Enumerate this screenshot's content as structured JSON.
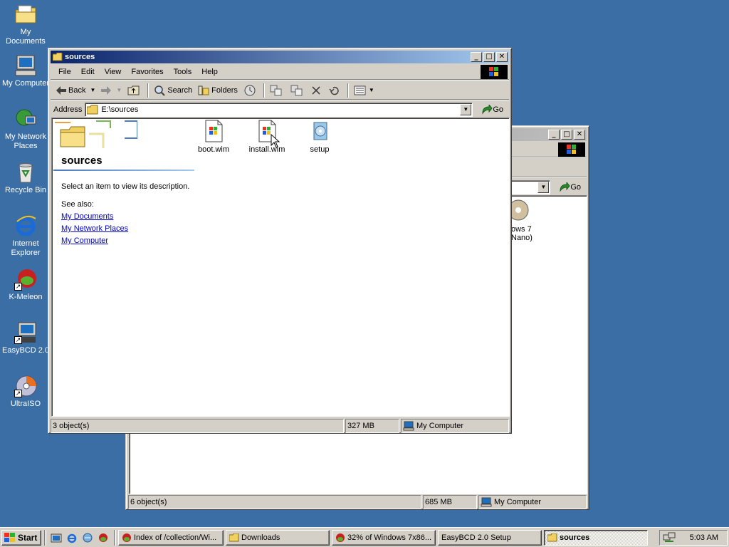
{
  "desktop": {
    "icons": [
      {
        "label": "My Documents",
        "icon": "my-documents-icon"
      },
      {
        "label": "My Computer",
        "icon": "my-computer-icon"
      },
      {
        "label": "My Network\nPlaces",
        "icon": "network-places-icon"
      },
      {
        "label": "Recycle Bin",
        "icon": "recycle-bin-icon"
      },
      {
        "label": "Internet\nExplorer",
        "icon": "internet-explorer-icon"
      },
      {
        "label": "K-Meleon",
        "icon": "k-meleon-icon"
      },
      {
        "label": "EasyBCD 2.0",
        "icon": "easybcd-icon"
      },
      {
        "label": "UltraISO",
        "icon": "ultraiso-icon"
      }
    ]
  },
  "back_window": {
    "go_label": "Go",
    "visible_item_text": "ows 7\nNano)",
    "status": {
      "objects": "6 object(s)",
      "size": "685 MB",
      "zone": "My Computer"
    }
  },
  "front_window": {
    "title": "sources",
    "menu": [
      "File",
      "Edit",
      "View",
      "Favorites",
      "Tools",
      "Help"
    ],
    "toolbar": {
      "back": "Back",
      "search": "Search",
      "folders": "Folders"
    },
    "address": {
      "label": "Address",
      "value": "E:\\sources",
      "go": "Go"
    },
    "webview": {
      "title": "sources",
      "description": "Select an item to view its description.",
      "see_also": "See also:",
      "links": [
        "My Documents",
        "My Network Places",
        "My Computer"
      ]
    },
    "files": [
      {
        "name": "boot.wim",
        "icon": "wim-file-icon"
      },
      {
        "name": "install.wim",
        "icon": "wim-file-icon"
      },
      {
        "name": "setup",
        "icon": "setup-icon"
      }
    ],
    "status": {
      "objects": "3 object(s)",
      "size": "327 MB",
      "zone": "My Computer"
    }
  },
  "taskbar": {
    "start": "Start",
    "tasks": [
      {
        "label": "Index of /collection/Wi...",
        "icon": "k-meleon-icon",
        "active": false
      },
      {
        "label": "Downloads",
        "icon": "folder-icon",
        "active": false
      },
      {
        "label": "32% of Windows 7x86...",
        "icon": "k-meleon-icon",
        "active": false
      },
      {
        "label": "EasyBCD 2.0 Setup",
        "icon": "none",
        "active": false
      },
      {
        "label": "sources",
        "icon": "folder-icon",
        "active": true
      }
    ],
    "clock": "5:03 AM"
  },
  "colors": {
    "desktop": "#3a6ea5",
    "title_active": "#0a246a",
    "title_inactive": "#808080",
    "link": "#0000cc"
  }
}
